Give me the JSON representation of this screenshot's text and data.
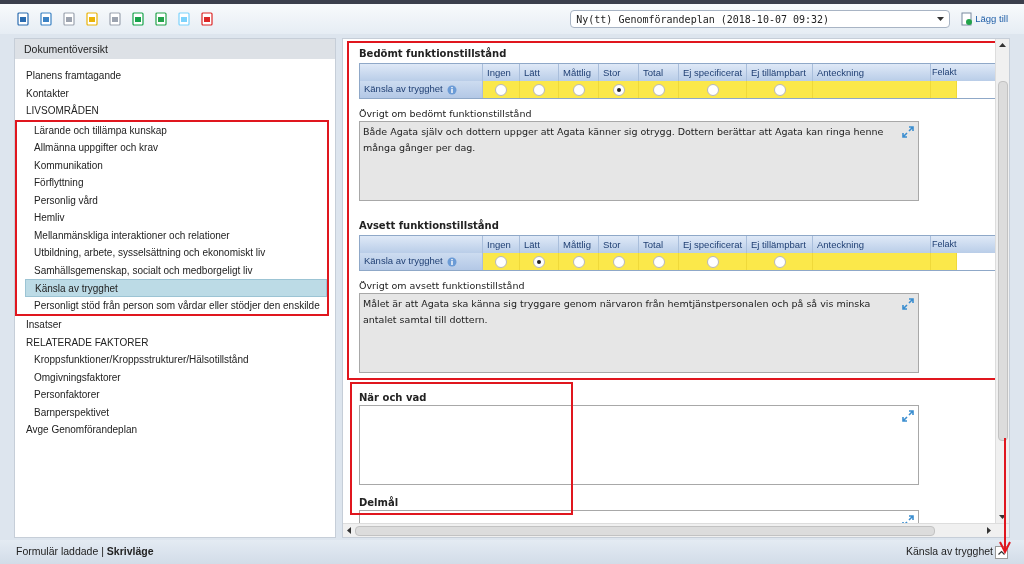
{
  "toolbar": {
    "plan_select": {
      "value": "Ny(tt) Genomförandeplan (2018-10-07 09:32)"
    },
    "add_button": "Lägg till"
  },
  "sidebar": {
    "title": "Dokumentöversikt",
    "items": [
      {
        "label": "Planens framtagande",
        "selected": false
      },
      {
        "label": "Kontakter",
        "selected": false
      },
      {
        "label": "LIVSOMRÅDEN",
        "selected": false,
        "highlighted": true,
        "children": [
          {
            "label": "Lärande och tillämpa kunskap",
            "selected": false
          },
          {
            "label": "Allmänna uppgifter och krav",
            "selected": false
          },
          {
            "label": "Kommunikation",
            "selected": false
          },
          {
            "label": "Förflyttning",
            "selected": false
          },
          {
            "label": "Personlig vård",
            "selected": false
          },
          {
            "label": "Hemliv",
            "selected": false
          },
          {
            "label": "Mellanmänskliga interaktioner och relationer",
            "selected": false
          },
          {
            "label": "Utbildning, arbete, sysselsättning och ekonomiskt liv",
            "selected": false
          },
          {
            "label": "Samhällsgemenskap, socialt och medborgeligt liv",
            "selected": false
          },
          {
            "label": "Känsla av trygghet",
            "selected": true
          },
          {
            "label": "Personligt stöd från person som vårdar eller stödjer den enskilde",
            "selected": false
          }
        ]
      },
      {
        "label": "Insatser",
        "selected": false
      },
      {
        "label": "RELATERADE FAKTORER",
        "selected": false,
        "children": [
          {
            "label": "Kroppsfunktioner/Kroppsstrukturer/Hälsotillstånd",
            "selected": false
          },
          {
            "label": "Omgivningsfaktorer",
            "selected": false
          },
          {
            "label": "Personfaktorer",
            "selected": false
          },
          {
            "label": "Barnperspektivet",
            "selected": false
          }
        ]
      },
      {
        "label": "Avge Genomförandeplan",
        "selected": false
      }
    ]
  },
  "assessment": {
    "highlighted": true,
    "sections": [
      {
        "title": "Bedömt funktionstillstånd",
        "columns": [
          "Ingen",
          "Lätt",
          "Måttlig",
          "Stor",
          "Total",
          "Ej specificerat",
          "Ej tillämpbart",
          "Anteckning",
          "Felakt"
        ],
        "rows": [
          {
            "label": "Känsla av trygghet",
            "options": [
              {
                "selected": false
              },
              {
                "selected": false
              },
              {
                "selected": false
              },
              {
                "selected": true
              },
              {
                "selected": false
              },
              {
                "selected": false
              },
              {
                "selected": false
              }
            ]
          }
        ],
        "note_label": "Övrigt om bedömt funktionstillstånd",
        "note_text": "Både Agata själv och dottern uppger att Agata känner sig otrygg. Dottern berättar att Agata kan ringa henne många gånger per dag."
      },
      {
        "title": "Avsett funktionstillstånd",
        "columns": [
          "Ingen",
          "Lätt",
          "Måttlig",
          "Stor",
          "Total",
          "Ej specificerat",
          "Ej tillämpbart",
          "Anteckning",
          "Felakt"
        ],
        "rows": [
          {
            "label": "Känsla av trygghet",
            "options": [
              {
                "selected": false
              },
              {
                "selected": true
              },
              {
                "selected": false
              },
              {
                "selected": false
              },
              {
                "selected": false
              },
              {
                "selected": false
              },
              {
                "selected": false
              }
            ]
          }
        ],
        "note_label": "Övrigt om avsett funktionstillstånd",
        "note_text": "Målet är att Agata ska känna sig tryggare genom närvaron från hemtjänstpersonalen och på så vis minska antalet samtal till dottern."
      }
    ]
  },
  "fields": [
    {
      "label": "När och vad"
    },
    {
      "label": "Delmål"
    }
  ],
  "status_bar": {
    "message": "Formulär laddade | **Skrivläge**",
    "section": "Känsla av trygghet"
  }
}
